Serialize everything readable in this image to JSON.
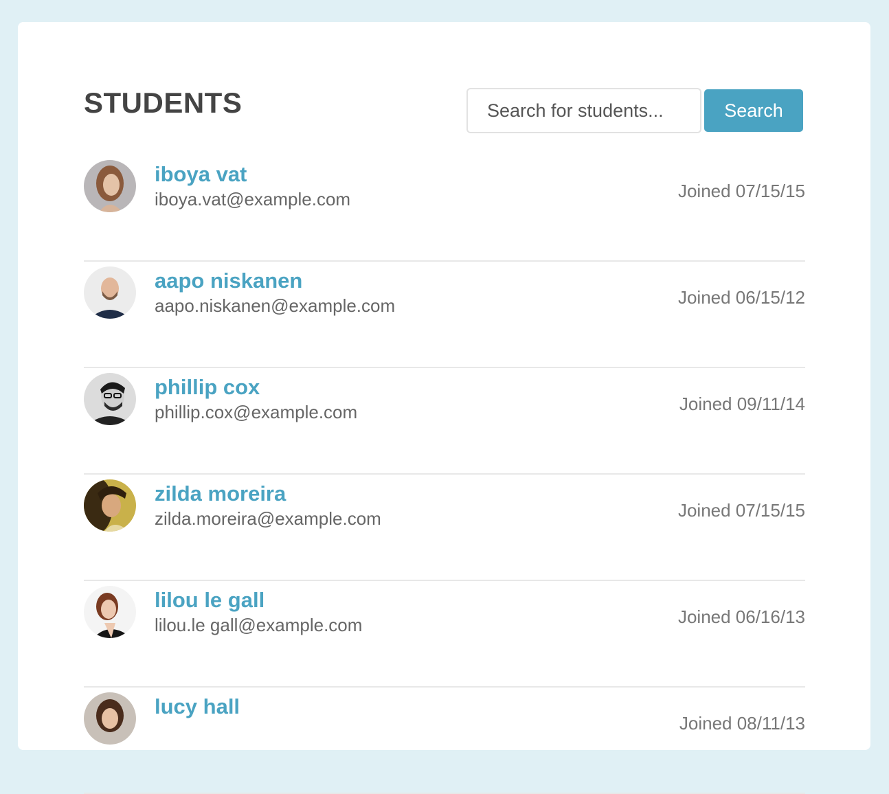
{
  "page": {
    "title": "STUDENTS"
  },
  "search": {
    "placeholder": "Search for students...",
    "button_label": "Search"
  },
  "colors": {
    "background": "#e0f0f5",
    "accent": "#4aa3c2",
    "title": "#444444",
    "muted": "#777777"
  },
  "students": [
    {
      "name": "iboya vat",
      "email": "iboya.vat@example.com",
      "joined": "Joined 07/15/15",
      "avatar": "woman-portrait-avatar"
    },
    {
      "name": "aapo niskanen",
      "email": "aapo.niskanen@example.com",
      "joined": "Joined 06/15/12",
      "avatar": "bald-man-portrait-avatar"
    },
    {
      "name": "phillip cox",
      "email": "phillip.cox@example.com",
      "joined": "Joined 09/11/14",
      "avatar": "man-glasses-portrait-avatar"
    },
    {
      "name": "zilda moreira",
      "email": "zilda.moreira@example.com",
      "joined": "Joined 07/15/15",
      "avatar": "woman-portrait-avatar"
    },
    {
      "name": "lilou le gall",
      "email": "lilou.le gall@example.com",
      "joined": "Joined 06/16/13",
      "avatar": "woman-portrait-avatar"
    },
    {
      "name": "lucy hall",
      "email": "",
      "joined": "Joined 08/11/13",
      "avatar": "woman-portrait-avatar"
    }
  ]
}
